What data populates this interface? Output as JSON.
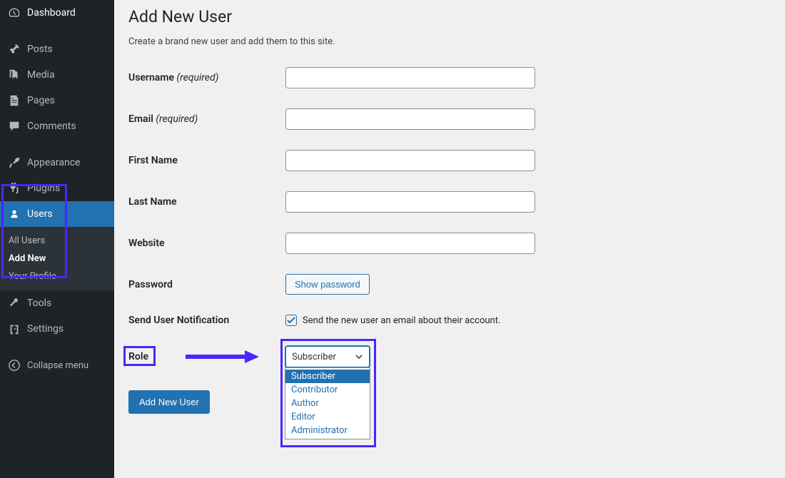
{
  "sidebar": {
    "items": [
      {
        "label": "Dashboard",
        "icon": "dashboard"
      },
      {
        "label": "Posts",
        "icon": "pin"
      },
      {
        "label": "Media",
        "icon": "media"
      },
      {
        "label": "Pages",
        "icon": "pages"
      },
      {
        "label": "Comments",
        "icon": "comments"
      },
      {
        "label": "Appearance",
        "icon": "appearance"
      },
      {
        "label": "Plugins",
        "icon": "plugins"
      },
      {
        "label": "Users",
        "icon": "users"
      },
      {
        "label": "Tools",
        "icon": "tools"
      },
      {
        "label": "Settings",
        "icon": "settings"
      }
    ],
    "submenu": [
      "All Users",
      "Add New",
      "Your Profile"
    ],
    "collapse": "Collapse menu"
  },
  "page": {
    "title": "Add New User",
    "subtitle": "Create a brand new user and add them to this site."
  },
  "form": {
    "username_label": "Username",
    "username_req": "(required)",
    "email_label": "Email",
    "email_req": "(required)",
    "firstname_label": "First Name",
    "lastname_label": "Last Name",
    "website_label": "Website",
    "password_label": "Password",
    "show_password_btn": "Show password",
    "notification_label": "Send User Notification",
    "notification_text": "Send the new user an email about their account.",
    "role_label": "Role",
    "role_selected": "Subscriber",
    "role_options": [
      "Subscriber",
      "Contributor",
      "Author",
      "Editor",
      "Administrator"
    ],
    "submit": "Add New User"
  },
  "colors": {
    "highlight": "#4a26fd",
    "primary": "#2271b1"
  }
}
